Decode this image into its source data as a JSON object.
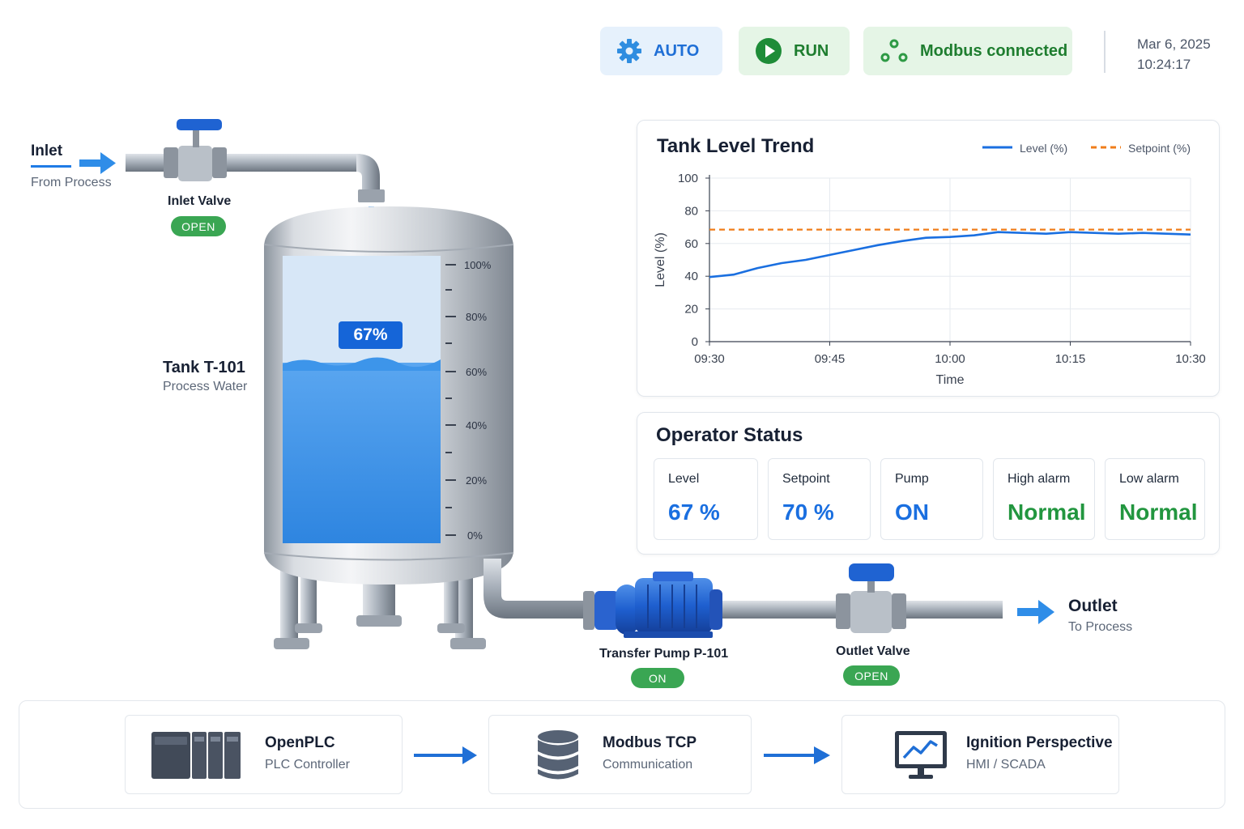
{
  "header": {
    "mode_label": "AUTO",
    "run_label": "RUN",
    "connection_label": "Modbus connected",
    "date": "Mar 6, 2025",
    "time": "10:24:17"
  },
  "process": {
    "inlet": {
      "title": "Inlet",
      "subtitle": "From Process"
    },
    "inlet_valve": {
      "label": "Inlet Valve",
      "state": "OPEN"
    },
    "tank": {
      "name": "Tank T-101",
      "medium": "Process Water",
      "level_display": "67%",
      "level_fraction": 0.67,
      "scale": [
        "100%",
        "80%",
        "60%",
        "40%",
        "20%",
        "0%"
      ]
    },
    "pump": {
      "label": "Transfer Pump P-101",
      "state": "ON"
    },
    "outlet_valve": {
      "label": "Outlet Valve",
      "state": "OPEN"
    },
    "outlet": {
      "title": "Outlet",
      "subtitle": "To Process"
    }
  },
  "trend": {
    "title": "Tank Level Trend",
    "legend_level": "Level (%)",
    "legend_setpoint": "Setpoint (%)"
  },
  "chart_data": {
    "type": "line",
    "title": "Tank Level Trend",
    "xlabel": "Time",
    "ylabel": "Level (%)",
    "ylim": [
      0,
      100
    ],
    "yticks": [
      "0",
      "20",
      "40",
      "60",
      "80",
      "100"
    ],
    "xticks": [
      "09:30",
      "09:45",
      "10:00",
      "10:15",
      "10:30"
    ],
    "grid": true,
    "legend_position": "top-right",
    "series": [
      {
        "name": "Level (%)",
        "color": "#1a6fe0",
        "style": "solid",
        "x": [
          "09:30",
          "09:33",
          "09:36",
          "09:39",
          "09:42",
          "09:45",
          "09:48",
          "09:51",
          "09:54",
          "09:57",
          "10:00",
          "10:03",
          "10:06",
          "10:09",
          "10:12",
          "10:15",
          "10:18",
          "10:21",
          "10:24",
          "10:27",
          "10:30"
        ],
        "y": [
          39.5,
          41,
          45,
          48,
          50,
          53,
          56,
          59,
          61.5,
          63.5,
          64,
          65,
          67,
          66.5,
          66,
          67,
          66.5,
          66,
          66.5,
          66,
          65.5
        ]
      },
      {
        "name": "Setpoint (%)",
        "color": "#f07d1a",
        "style": "dashed",
        "x": [
          "09:30",
          "10:30"
        ],
        "y": [
          68.5,
          68.5
        ]
      }
    ]
  },
  "operator_status": {
    "title": "Operator Status",
    "tiles": [
      {
        "label": "Level",
        "value": "67 %"
      },
      {
        "label": "Setpoint",
        "value": "70 %"
      },
      {
        "label": "Pump",
        "value": "ON"
      },
      {
        "label": "High alarm",
        "value": "Normal"
      },
      {
        "label": "Low alarm",
        "value": "Normal"
      }
    ]
  },
  "architecture": [
    {
      "title": "OpenPLC",
      "subtitle": "PLC Controller",
      "icon": "plc-icon"
    },
    {
      "title": "Modbus TCP",
      "subtitle": "Communication",
      "icon": "database-icon"
    },
    {
      "title": "Ignition Perspective",
      "subtitle": "HMI / SCADA",
      "icon": "monitor-chart-icon"
    }
  ],
  "colors": {
    "accent_blue": "#1a6fe0",
    "ok_green": "#22963f",
    "setpoint_orange": "#f07d1a",
    "water": "#3d8fe6"
  }
}
